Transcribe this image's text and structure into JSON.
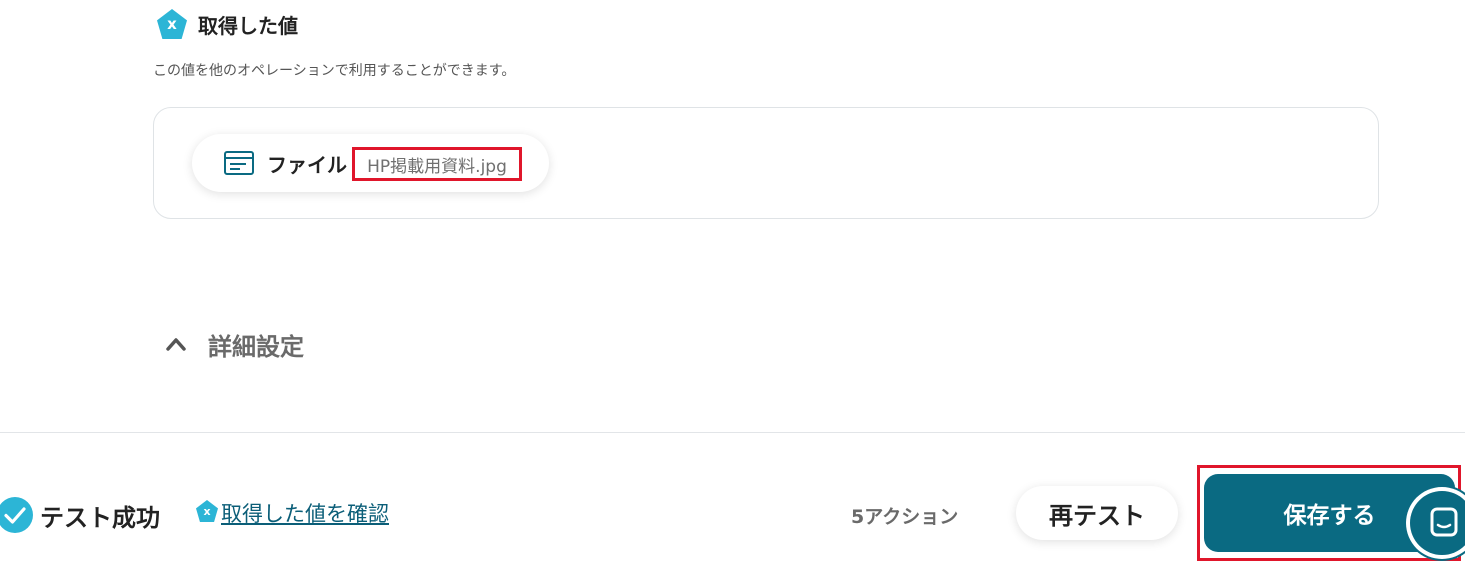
{
  "section": {
    "icon_glyph": "x",
    "title": "取得した値",
    "description": "この値を他のオペレーションで利用することができます。"
  },
  "value_item": {
    "icon": "file-window-icon",
    "label": "ファイル",
    "value": "HP掲載用資料.jpg"
  },
  "details": {
    "toggle_icon": "chevron-up-icon",
    "label": "詳細設定"
  },
  "footer": {
    "status_icon": "check-circle-icon",
    "status_text": "テスト成功",
    "link_icon_glyph": "x",
    "view_values_link": "取得した値を確認",
    "action_count": "5アクション",
    "retest_label": "再テスト",
    "save_label": "保存する",
    "chat_icon": "chat-icon"
  },
  "colors": {
    "accent": "#2cb5d6",
    "primary": "#0a6a82",
    "highlight": "#e0162b",
    "link": "#0b5e78"
  }
}
